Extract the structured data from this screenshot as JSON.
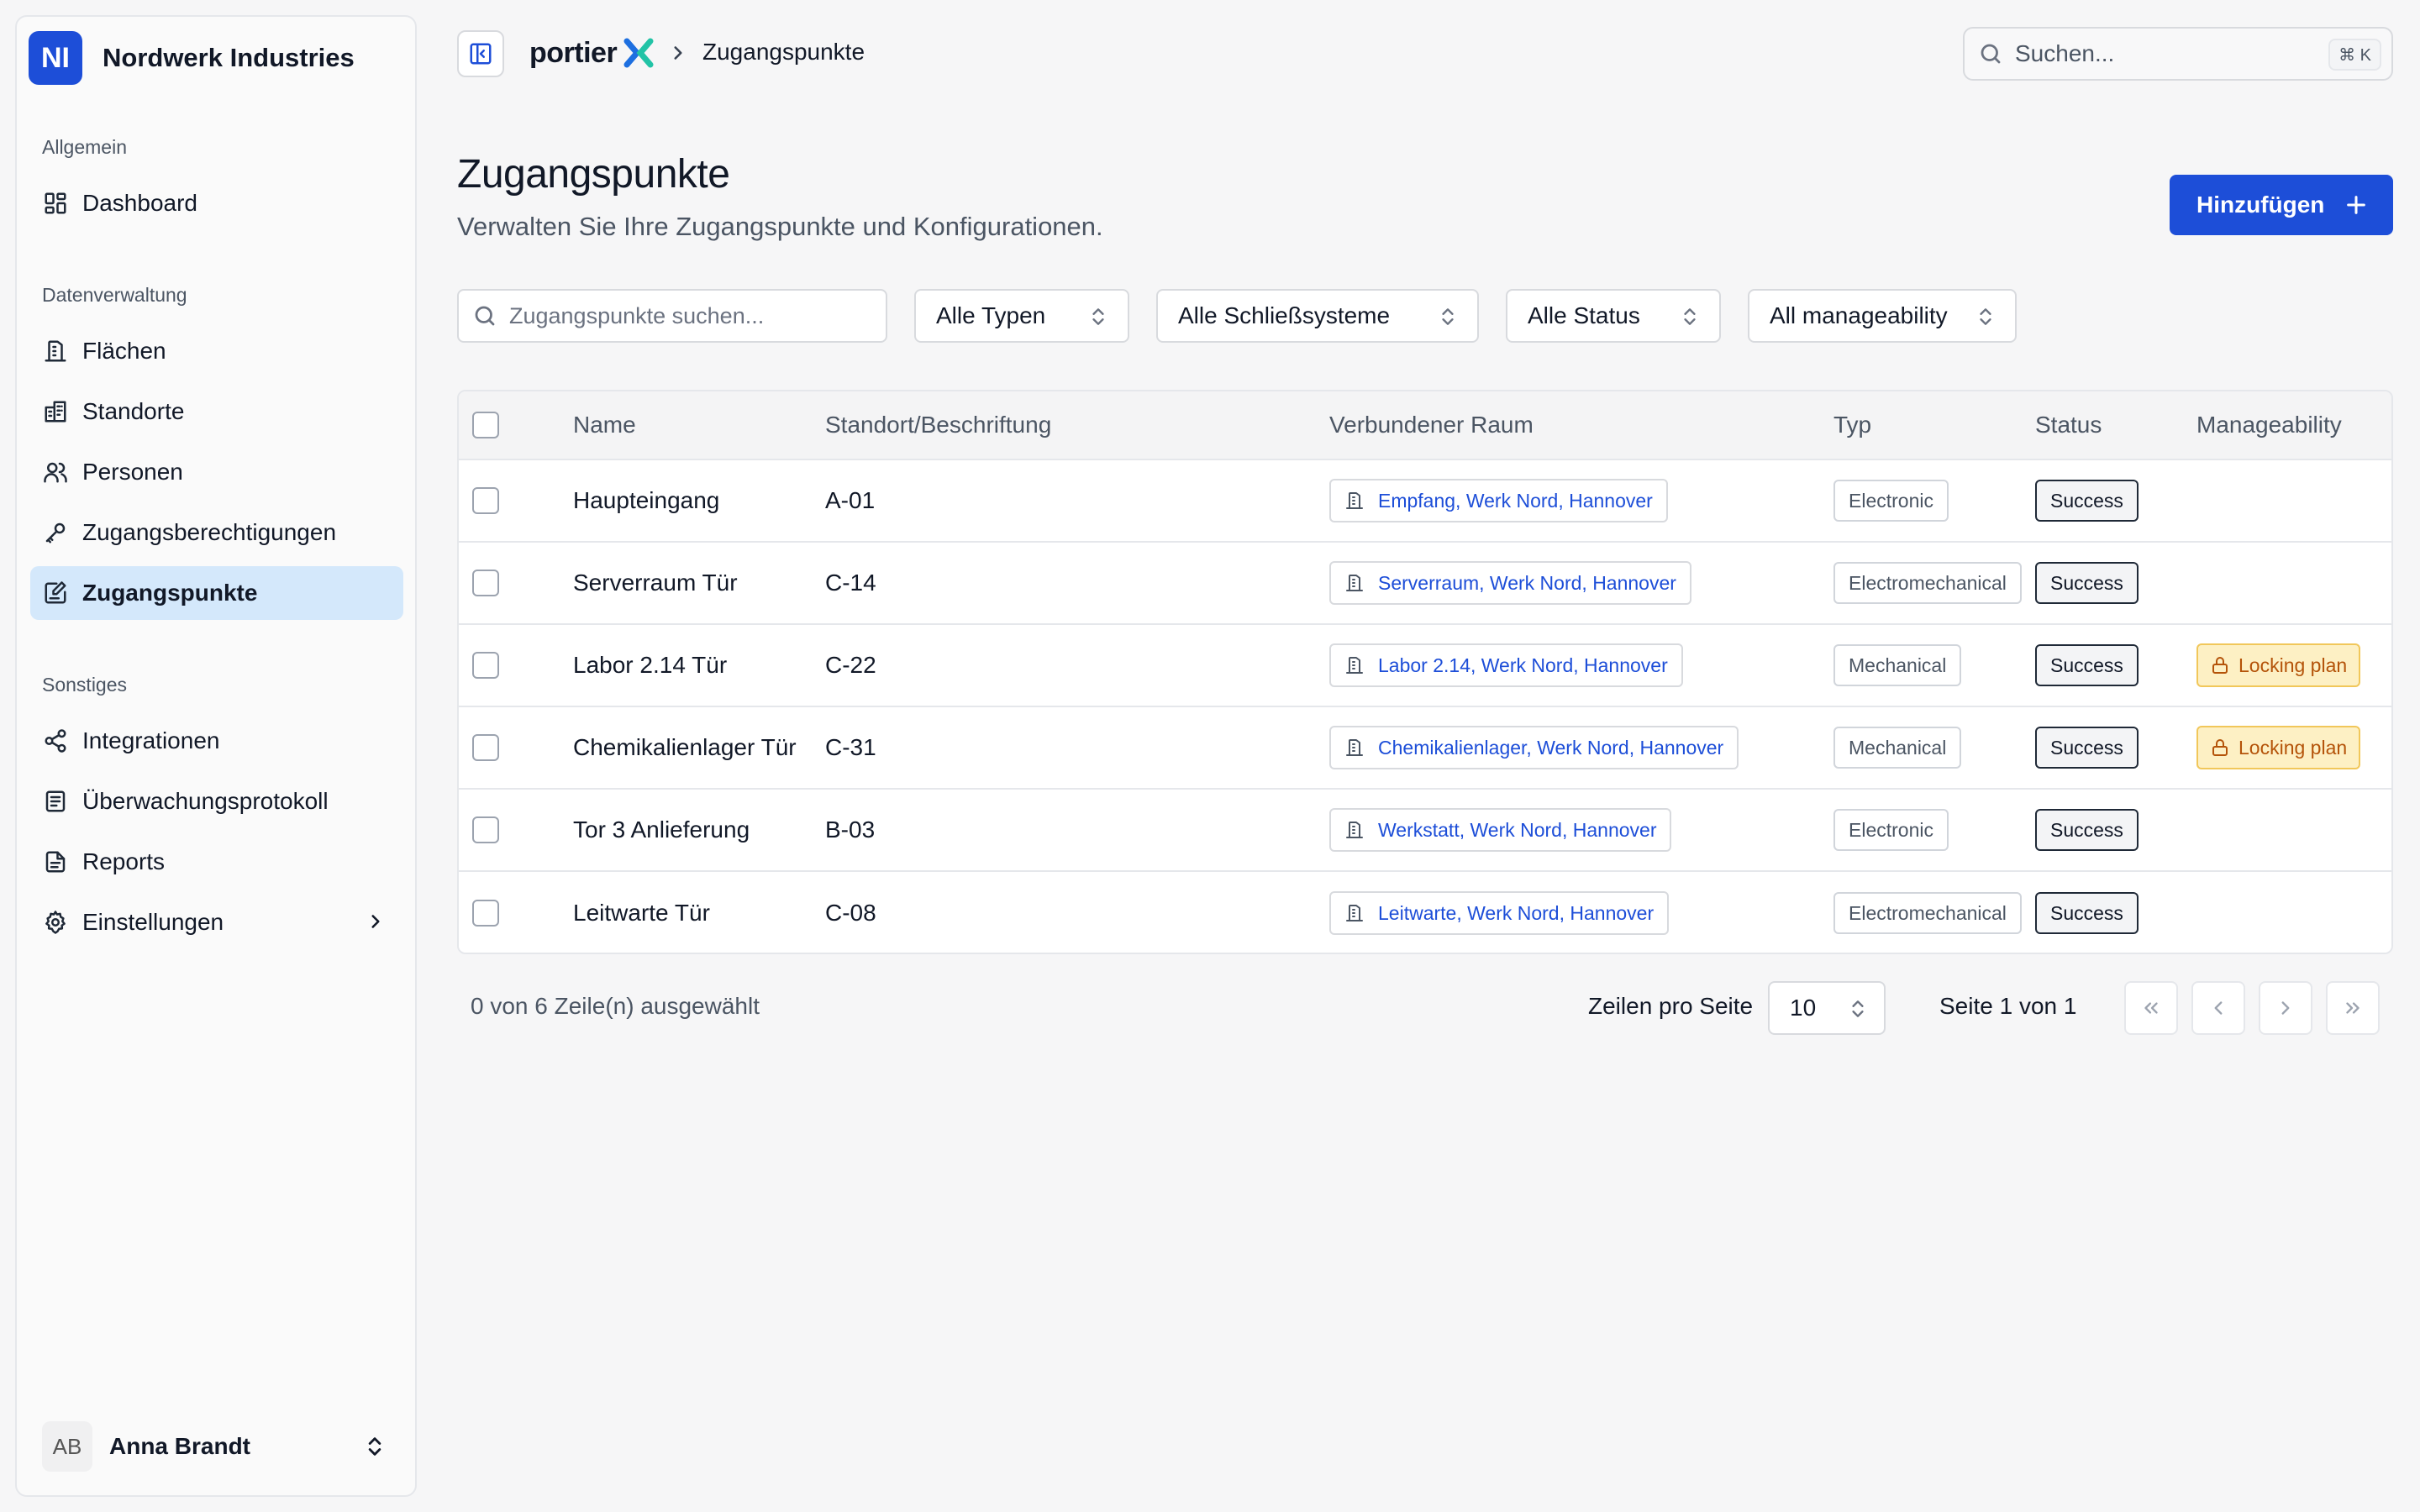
{
  "org": {
    "initials": "NI",
    "name": "Nordwerk Industries"
  },
  "sidebar": {
    "sections": [
      {
        "label": "Allgemein"
      },
      {
        "label": "Datenverwaltung"
      },
      {
        "label": "Sonstiges"
      }
    ],
    "items": [
      {
        "label": "Dashboard",
        "icon": "dashboard-icon"
      },
      {
        "label": "Flächen",
        "icon": "building-icon"
      },
      {
        "label": "Standorte",
        "icon": "buildings-icon"
      },
      {
        "label": "Personen",
        "icon": "users-icon"
      },
      {
        "label": "Zugangsberechtigungen",
        "icon": "key-icon"
      },
      {
        "label": "Zugangspunkte",
        "icon": "door-edit-icon",
        "active": true
      },
      {
        "label": "Integrationen",
        "icon": "share-icon"
      },
      {
        "label": "Überwachungsprotokoll",
        "icon": "log-icon"
      },
      {
        "label": "Reports",
        "icon": "file-icon"
      },
      {
        "label": "Einstellungen",
        "icon": "gear-icon"
      }
    ],
    "user": {
      "initials": "AB",
      "name": "Anna Brandt"
    }
  },
  "topbar": {
    "brand": "portier",
    "breadcrumb_current": "Zugangspunkte",
    "search_placeholder": "Suchen...",
    "shortcut": "⌘ K"
  },
  "page": {
    "title": "Zugangspunkte",
    "subtitle": "Verwalten Sie Ihre Zugangspunkte und Konfigurationen.",
    "add_label": "Hinzufügen"
  },
  "filters": {
    "search_placeholder": "Zugangspunkte suchen...",
    "type": "Alle Typen",
    "locking": "Alle Schließsysteme",
    "status": "Alle Status",
    "manageability": "All manageability"
  },
  "table": {
    "headers": {
      "name": "Name",
      "location": "Standort/Beschriftung",
      "room": "Verbundener Raum",
      "type": "Typ",
      "status": "Status",
      "manageability": "Manageability"
    },
    "rows": [
      {
        "name": "Haupteingang",
        "location": "A-01",
        "room": "Empfang, Werk Nord, Hannover",
        "type": "Electronic",
        "status": "Success",
        "manageability": ""
      },
      {
        "name": "Serverraum Tür",
        "location": "C-14",
        "room": "Serverraum, Werk Nord, Hannover",
        "type": "Electromechanical",
        "status": "Success",
        "manageability": ""
      },
      {
        "name": "Labor 2.14 Tür",
        "location": "C-22",
        "room": "Labor 2.14, Werk Nord, Hannover",
        "type": "Mechanical",
        "status": "Success",
        "manageability": "Locking plan"
      },
      {
        "name": "Chemikalienlager Tür",
        "location": "C-31",
        "room": "Chemikalienlager, Werk Nord, Hannover",
        "type": "Mechanical",
        "status": "Success",
        "manageability": "Locking plan"
      },
      {
        "name": "Tor 3 Anlieferung",
        "location": "B-03",
        "room": "Werkstatt, Werk Nord, Hannover",
        "type": "Electronic",
        "status": "Success",
        "manageability": ""
      },
      {
        "name": "Leitwarte Tür",
        "location": "C-08",
        "room": "Leitwarte, Werk Nord, Hannover",
        "type": "Electromechanical",
        "status": "Success",
        "manageability": ""
      }
    ]
  },
  "footer": {
    "selected": "0 von 6 Zeile(n) ausgewählt",
    "rows_per_page_label": "Zeilen pro Seite",
    "rows_per_page": "10",
    "page_info": "Seite 1 von 1"
  },
  "colors": {
    "accent": "#1d4ed8",
    "active_nav": "#d4e8fb",
    "warning_bg": "#fdf0c4",
    "warning_text": "#b45309"
  }
}
